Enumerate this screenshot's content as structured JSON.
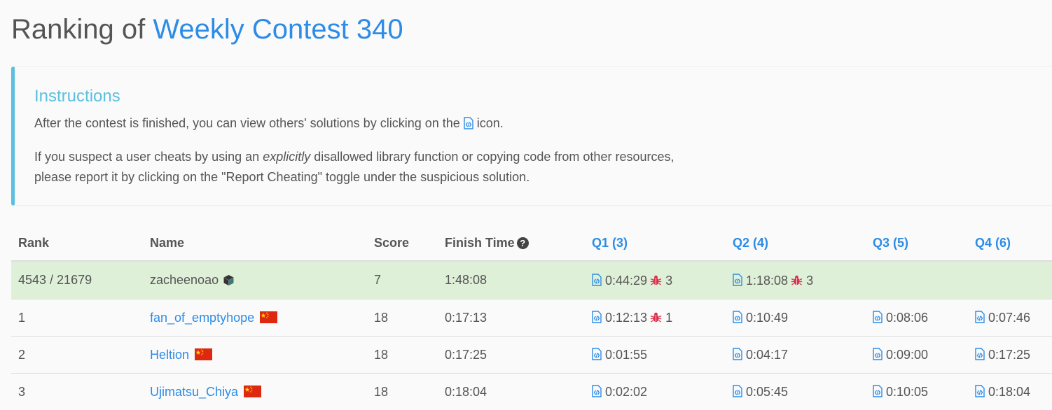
{
  "title": {
    "prefix": "Ranking of ",
    "contest": "Weekly Contest 340"
  },
  "instructions": {
    "heading": "Instructions",
    "p1_before": "After the contest is finished, you can view others' solutions by clicking on the ",
    "p1_after": " icon.",
    "p2_a": "If you suspect a user cheats by using an ",
    "p2_em": "explicitly",
    "p2_b": " disallowed library function or copying code from other resources,",
    "p2_c": "please report it by clicking on the \"Report Cheating\" toggle under the suspicious solution."
  },
  "table": {
    "headers": {
      "rank": "Rank",
      "name": "Name",
      "score": "Score",
      "finish": "Finish Time",
      "q1": "Q1 (3)",
      "q2": "Q2 (4)",
      "q3": "Q3 (5)",
      "q4": "Q4 (6)"
    },
    "current_user": {
      "rank": "4543 / 21679",
      "name": "zacheenoao",
      "score": "7",
      "finish": "1:48:08",
      "q1": "0:44:29",
      "q1_bugs": "3",
      "q2": "1:18:08",
      "q2_bugs": "3"
    },
    "rows": [
      {
        "rank": "1",
        "name": "fan_of_emptyhope",
        "score": "18",
        "finish": "0:17:13",
        "q1": "0:12:13",
        "q1_bugs": "1",
        "q2": "0:10:49",
        "q3": "0:08:06",
        "q4": "0:07:46"
      },
      {
        "rank": "2",
        "name": "Heltion",
        "score": "18",
        "finish": "0:17:25",
        "q1": "0:01:55",
        "q2": "0:04:17",
        "q3": "0:09:00",
        "q4": "0:17:25"
      },
      {
        "rank": "3",
        "name": "Ujimatsu_Chiya",
        "score": "18",
        "finish": "0:18:04",
        "q1": "0:02:02",
        "q2": "0:05:45",
        "q3": "0:10:05",
        "q4": "0:18:04"
      }
    ]
  },
  "icons": {
    "solution": "code-file-icon",
    "bug": "bug-icon",
    "help": "question-circle-icon",
    "flag": "china-flag-icon",
    "avatar": "cube-avatar-icon"
  },
  "colors": {
    "accent": "#2c8ce6",
    "info": "#5bc0de",
    "highlight_row": "#dff0d8",
    "bug": "#d9304f",
    "flag": "#de2910"
  }
}
